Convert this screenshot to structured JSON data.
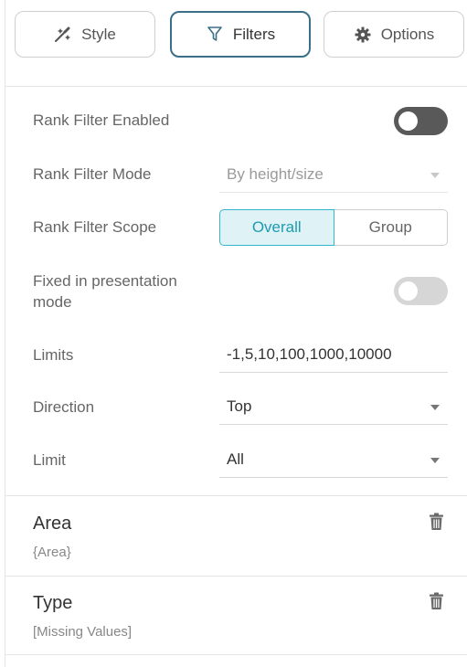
{
  "tabs": [
    {
      "label": "Style",
      "icon": "magic-wand-icon"
    },
    {
      "label": "Filters",
      "icon": "funnel-icon"
    },
    {
      "label": "Options",
      "icon": "gear-icon"
    }
  ],
  "active_tab": "Filters",
  "rank_filter": {
    "enabled_label": "Rank Filter Enabled",
    "mode_label": "Rank Filter Mode",
    "mode_value": "By height/size",
    "scope_label": "Rank Filter Scope",
    "scope_options": [
      "Overall",
      "Group"
    ],
    "scope_selected": "Overall",
    "fixed_label_line1": "Fixed in presentation",
    "fixed_label_line2": "mode",
    "limits_label": "Limits",
    "limits_value": "-1,5,10,100,1000,10000",
    "direction_label": "Direction",
    "direction_value": "Top",
    "limit_label": "Limit",
    "limit_value": "All"
  },
  "filters": [
    {
      "title": "Area",
      "subtitle": "{Area}"
    },
    {
      "title": "Type",
      "subtitle": "[Missing Values]"
    }
  ],
  "colors": {
    "accent": "#3b6f88",
    "segment_active": "#1d9bb0",
    "toggle_on_track": "#595959"
  }
}
